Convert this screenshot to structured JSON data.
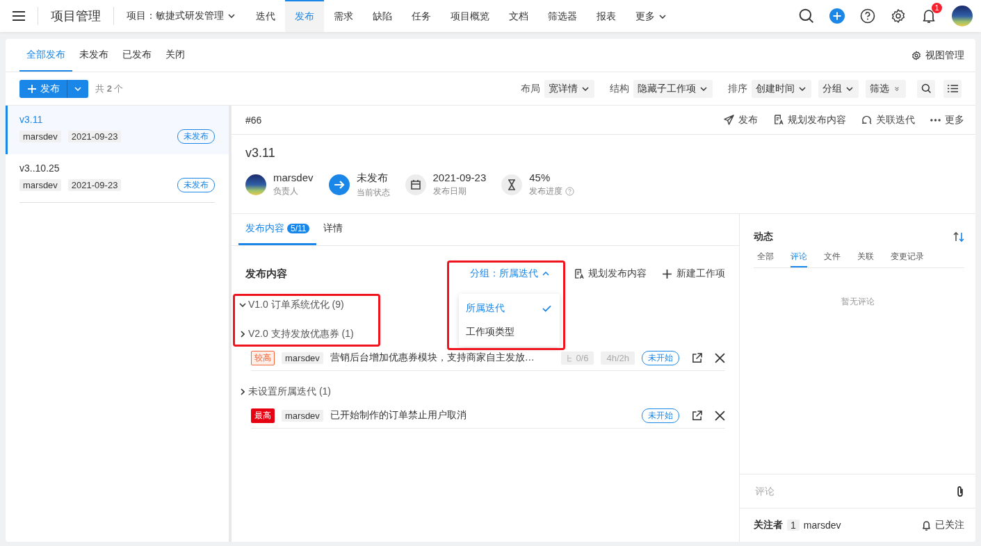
{
  "nav": {
    "title": "项目管理",
    "project": "项目：敏捷式研发管理",
    "tabs": [
      {
        "label": "迭代",
        "selected": false,
        "dropdown": false
      },
      {
        "label": "发布",
        "selected": true,
        "dropdown": false
      },
      {
        "label": "需求",
        "selected": false,
        "dropdown": false
      },
      {
        "label": "缺陷",
        "selected": false,
        "dropdown": false
      },
      {
        "label": "任务",
        "selected": false,
        "dropdown": false
      },
      {
        "label": "项目概览",
        "selected": false,
        "dropdown": false
      },
      {
        "label": "文档",
        "selected": false,
        "dropdown": false
      },
      {
        "label": "筛选器",
        "selected": false,
        "dropdown": false
      },
      {
        "label": "报表",
        "selected": false,
        "dropdown": false
      },
      {
        "label": "更多",
        "selected": false,
        "dropdown": true
      }
    ],
    "notification_count": "1"
  },
  "view_tabs": [
    {
      "label": "全部发布",
      "selected": true
    },
    {
      "label": "未发布",
      "selected": false
    },
    {
      "label": "已发布",
      "selected": false
    },
    {
      "label": "关闭",
      "selected": false
    }
  ],
  "view_manage": "视图管理",
  "toolbar": {
    "create": "发布",
    "count": "共 **2** 个",
    "options": [
      {
        "kind": "select",
        "label": "布局",
        "value": "宽详情"
      },
      {
        "kind": "select",
        "label": "结构",
        "value": "隐藏子工作项"
      },
      {
        "kind": "select",
        "label": "排序",
        "value": "创建时间"
      },
      {
        "kind": "select",
        "value": "分组"
      },
      {
        "kind": "filter",
        "value": "筛选"
      }
    ]
  },
  "releases": [
    {
      "name": "v3.11",
      "owner": "marsdev",
      "date": "2021-09-23",
      "status": "未发布",
      "selected": true
    },
    {
      "name": "v3..10.25",
      "owner": "marsdev",
      "date": "2021-09-23",
      "status": "未发布",
      "selected": false
    }
  ],
  "detail": {
    "number": "#66",
    "actions": [
      "发布",
      "规划发布内容",
      "关联迭代",
      "更多"
    ],
    "title": "v3.11",
    "fields": [
      {
        "kind": "avatar",
        "value": "marsdev",
        "label": "负责人",
        "help": false
      },
      {
        "kind": "status",
        "value": "未发布",
        "label": "当前状态",
        "help": false
      },
      {
        "kind": "date",
        "value": "2021-09-23",
        "label": "发布日期",
        "help": false
      },
      {
        "kind": "progress",
        "value": "45%",
        "label": "发布进度",
        "help": true
      }
    ],
    "tabs": [
      {
        "label": "发布内容",
        "count": "5/11",
        "selected": true
      },
      {
        "label": "详情",
        "selected": false
      }
    ],
    "content": {
      "heading": "发布内容",
      "group_by": "分组：所属迭代",
      "group_menu_open": true,
      "group_menu_highlighted": true,
      "group_menu": [
        {
          "label": "所属迭代",
          "selected": true
        },
        {
          "label": "工作项类型",
          "selected": false
        }
      ],
      "actions": [
        "规划发布内容",
        "新建工作项"
      ],
      "groups_highlighted": true,
      "groups": [
        {
          "title": "V1.0 订单系统优化 (9)",
          "expanded": true
        },
        {
          "title": "V2.0 支持发放优惠券 (1)",
          "expanded": false,
          "items": [
            {
              "priority": "较高",
              "kind": "light",
              "color": "#f5673a",
              "owner": "marsdev",
              "title": "营销后台增加优惠券模块，支持商家自主发放…",
              "subtasks": "0/6",
              "hours": "4h/2h",
              "status": "未开始"
            }
          ]
        },
        {
          "title": "未设置所属迭代 (1)",
          "expanded": false,
          "items": [
            {
              "priority": "最高",
              "kind": "solid",
              "color": "#e60012",
              "owner": "marsdev",
              "title": "已开始制作的订单禁止用户取消",
              "status": "未开始"
            }
          ]
        }
      ]
    }
  },
  "activity": {
    "title": "动态",
    "tabs": [
      {
        "label": "全部",
        "selected": false
      },
      {
        "label": "评论",
        "selected": true
      },
      {
        "label": "文件",
        "selected": false
      },
      {
        "label": "关联",
        "selected": false
      },
      {
        "label": "变更记录",
        "selected": false
      }
    ],
    "empty": "暂无评论",
    "comment_placeholder": "评论",
    "followers_label": "关注者",
    "followers_count": "1",
    "follower": "marsdev",
    "follow_state": "已关注"
  }
}
